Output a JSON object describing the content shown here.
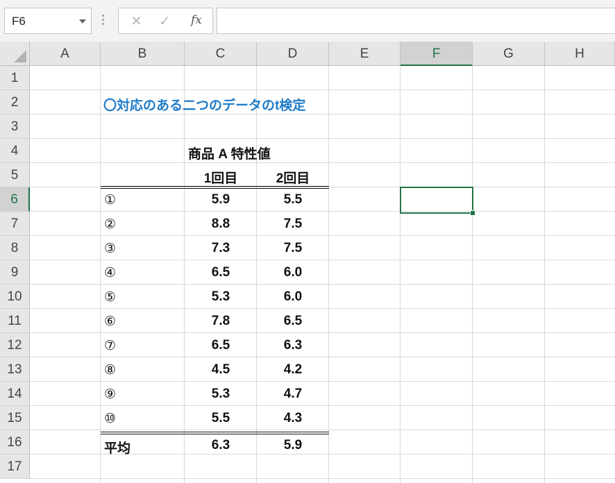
{
  "name_box": "F6",
  "formula_bar": {
    "cancel_icon": "✕",
    "enter_icon": "✓",
    "fx_label": "fx",
    "value": ""
  },
  "columns": [
    "A",
    "B",
    "C",
    "D",
    "E",
    "F",
    "G",
    "H"
  ],
  "rows": [
    "1",
    "2",
    "3",
    "4",
    "5",
    "6",
    "7",
    "8",
    "9",
    "10",
    "11",
    "12",
    "13",
    "14",
    "15",
    "16",
    "17"
  ],
  "selected_cell": {
    "column": "F",
    "row": "6"
  },
  "sheet": {
    "title": "〇対応のある二つのデータのt検定",
    "header_group": "商品 A 特性値",
    "header_col1": "1回目",
    "header_col2": "2回目",
    "data_rows": [
      {
        "label": "①",
        "c": "5.9",
        "d": "5.5"
      },
      {
        "label": "②",
        "c": "8.8",
        "d": "7.5"
      },
      {
        "label": "③",
        "c": "7.3",
        "d": "7.5"
      },
      {
        "label": "④",
        "c": "6.5",
        "d": "6.0"
      },
      {
        "label": "⑤",
        "c": "5.3",
        "d": "6.0"
      },
      {
        "label": "⑥",
        "c": "7.8",
        "d": "6.5"
      },
      {
        "label": "⑦",
        "c": "6.5",
        "d": "6.3"
      },
      {
        "label": "⑧",
        "c": "4.5",
        "d": "4.2"
      },
      {
        "label": "⑨",
        "c": "5.3",
        "d": "4.7"
      },
      {
        "label": "⑩",
        "c": "5.5",
        "d": "4.3"
      }
    ],
    "avg_label": "平均",
    "avg_c": "6.3",
    "avg_d": "5.9"
  },
  "colors": {
    "accent": "#217346",
    "title": "#1f7bc8"
  }
}
